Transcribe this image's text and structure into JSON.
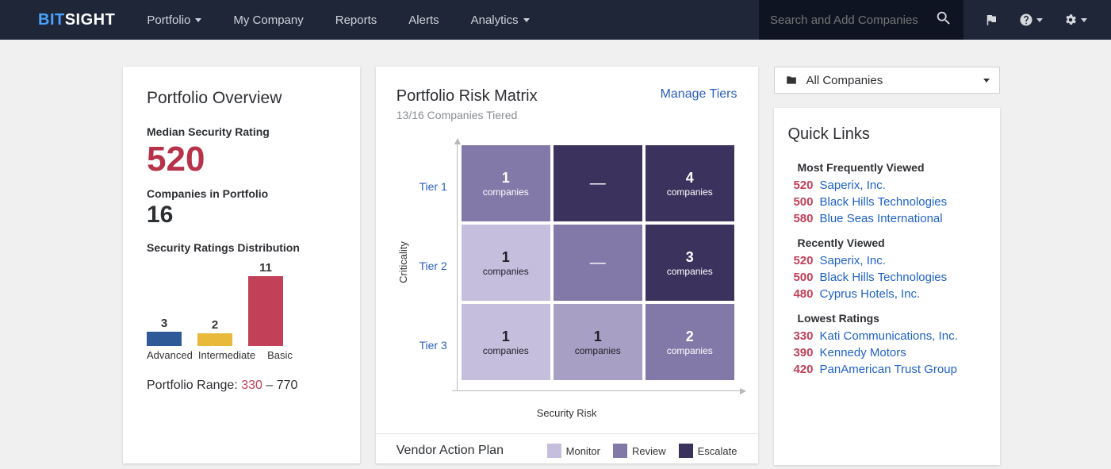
{
  "header": {
    "logo1": "BIT",
    "logo2": "SIGHT",
    "nav": [
      "Portfolio",
      "My Company",
      "Reports",
      "Alerts",
      "Analytics"
    ],
    "search_placeholder": "Search and Add Companies"
  },
  "overview": {
    "title": "Portfolio Overview",
    "median_label": "Median Security Rating",
    "median_value": "520",
    "count_label": "Companies in Portfolio",
    "count_value": "16",
    "dist_label": "Security Ratings Distribution",
    "range_label": "Portfolio Range: ",
    "range_low": "330",
    "range_sep": " – ",
    "range_high": "770"
  },
  "chart_data": {
    "type": "bar",
    "categories": [
      "Advanced",
      "Intermediate",
      "Basic"
    ],
    "values": [
      3,
      2,
      11
    ],
    "colors": [
      "#2f5a98",
      "#e9b93b",
      "#c34059"
    ],
    "title": "Security Ratings Distribution",
    "ylim": [
      0,
      12
    ]
  },
  "matrix": {
    "title": "Portfolio Risk Matrix",
    "sub": "13/16 Companies Tiered",
    "manage": "Manage Tiers",
    "tiers": [
      "Tier 1",
      "Tier 2",
      "Tier 3"
    ],
    "ylabel": "Criticality",
    "xlabel": "Security Risk",
    "cells": {
      "r0c0": {
        "n": "1",
        "c": "companies"
      },
      "r0c1": {
        "n": "—",
        "c": ""
      },
      "r0c2": {
        "n": "4",
        "c": "companies"
      },
      "r1c0": {
        "n": "1",
        "c": "companies"
      },
      "r1c1": {
        "n": "—",
        "c": ""
      },
      "r1c2": {
        "n": "3",
        "c": "companies"
      },
      "r2c0": {
        "n": "1",
        "c": "companies"
      },
      "r2c1": {
        "n": "1",
        "c": "companies"
      },
      "r2c2": {
        "n": "2",
        "c": "companies"
      }
    },
    "vap_title": "Vendor Action Plan",
    "legend": {
      "mon": "Monitor",
      "rev": "Review",
      "esc": "Escalate"
    }
  },
  "right": {
    "selector": "All Companies",
    "ql_title": "Quick Links",
    "groups": {
      "g1": "Most Frequently Viewed",
      "g2": "Recently Viewed",
      "g3": "Lowest Ratings"
    },
    "g1_items": [
      {
        "r": "520",
        "n": "Saperix, Inc."
      },
      {
        "r": "500",
        "n": "Black Hills Technologies"
      },
      {
        "r": "580",
        "n": "Blue Seas International"
      }
    ],
    "g2_items": [
      {
        "r": "520",
        "n": "Saperix, Inc."
      },
      {
        "r": "500",
        "n": "Black Hills Technologies"
      },
      {
        "r": "480",
        "n": "Cyprus Hotels, Inc."
      }
    ],
    "g3_items": [
      {
        "r": "330",
        "n": "Kati Communications, Inc."
      },
      {
        "r": "390",
        "n": "Kennedy Motors"
      },
      {
        "r": "420",
        "n": "PanAmerican Trust Group"
      }
    ]
  }
}
